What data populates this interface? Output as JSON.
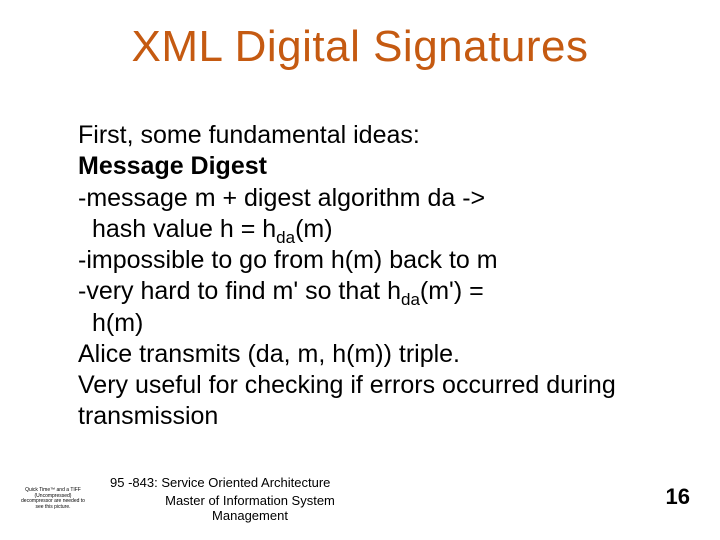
{
  "title": "XML Digital Signatures",
  "body": {
    "intro": "First, some fundamental ideas:",
    "heading": "Message Digest",
    "line1a": "-message m + digest algorithm da ->",
    "line1b": "hash value h = h",
    "line1b_sub": "da",
    "line1b_end": "(m)",
    "line2": "-impossible to go from h(m) back to m",
    "line3a": "-very hard to find m' so that h",
    "line3a_sub": "da",
    "line3a_end": "(m') =",
    "line3b": "h(m)",
    "line4": "Alice transmits (da, m, h(m)) triple.",
    "line5": "Very useful for checking if errors occurred during transmission"
  },
  "footer": {
    "course": "95 -843: Service Oriented Architecture",
    "subtitle": "Master of Information System Management",
    "pagenum": "16",
    "placeholder": "Quick Time™ and a TIFF (Uncompressed) decompressor are needed to see this picture."
  }
}
